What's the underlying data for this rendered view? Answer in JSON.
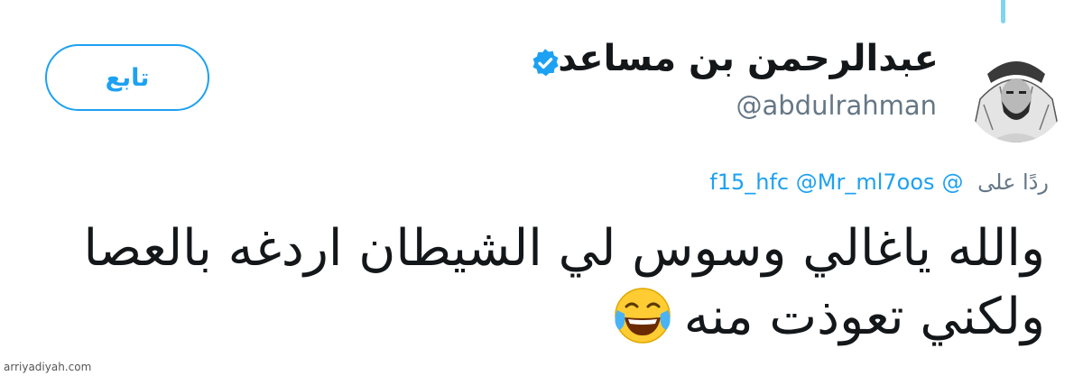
{
  "tweet": {
    "author": {
      "display_name": "عبدالرحمن بن مساعد",
      "handle": "@abdulrahman",
      "verified": true,
      "verified_icon": "verified-badge-icon",
      "avatar": "avatar"
    },
    "follow_button": {
      "label": "تابع"
    },
    "reply_to": {
      "prefix": "ردًا على",
      "mentions": [
        "@f15_hfc",
        "@Mr_ml7oos"
      ]
    },
    "text_line_1": "والله ياغالي وسوس لي الشيطان اردغه بالعصا",
    "text_line_2": "ولكني تعوذت منه",
    "emoji": "face-with-tears-of-joy-icon"
  },
  "watermark": "arriyadiyah.com",
  "colors": {
    "accent": "#1da1f2",
    "text": "#14171a",
    "secondary_text": "#657786",
    "thread_line": "#7fd4f0"
  }
}
